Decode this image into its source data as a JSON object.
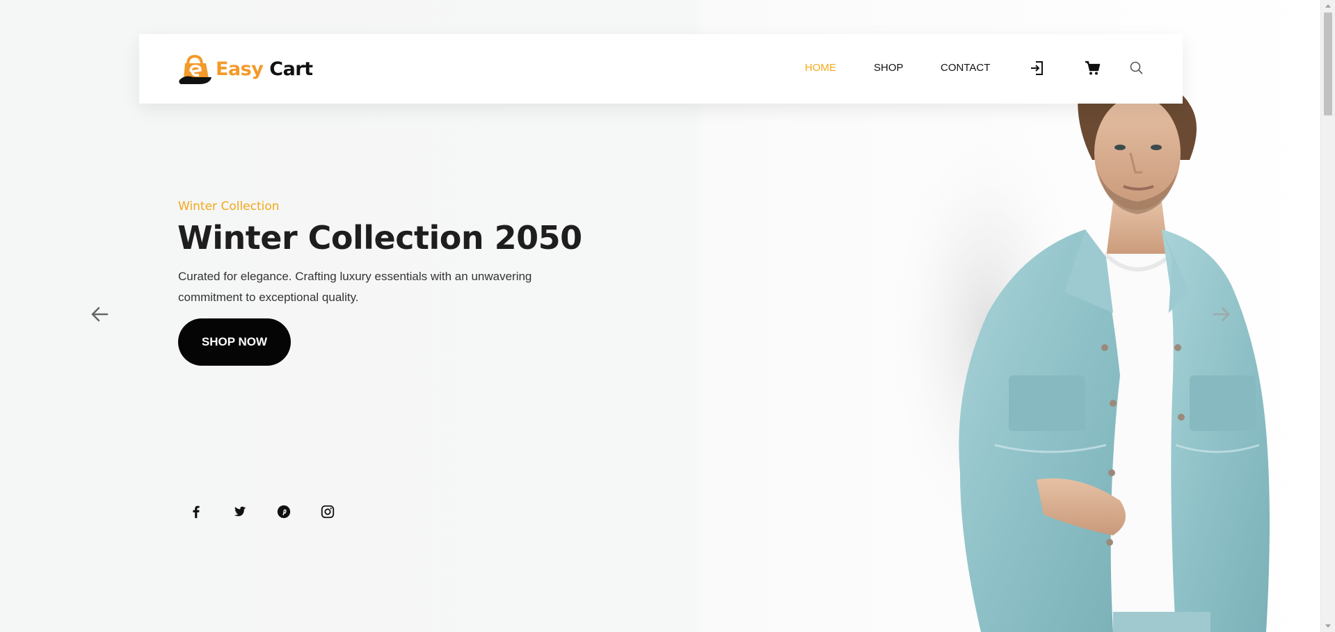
{
  "brand": {
    "name_part1": "Easy",
    "name_part2": "Cart",
    "accent_color": "#f3a81a"
  },
  "nav": {
    "links": [
      {
        "label": "HOME",
        "active": true
      },
      {
        "label": "SHOP",
        "active": false
      },
      {
        "label": "CONTACT",
        "active": false
      }
    ],
    "icons": [
      "login-icon",
      "cart-icon",
      "search-icon"
    ]
  },
  "hero": {
    "eyebrow": "Winter Collection",
    "title": "Winter Collection 2050",
    "description": "Curated for elegance. Crafting luxury essentials with an unwavering commitment to exceptional quality.",
    "cta_label": "SHOP NOW",
    "image_alt": "man-in-denim-jacket"
  },
  "carousel": {
    "prev_icon": "arrow-left-icon",
    "next_icon": "arrow-right-icon"
  },
  "socials": [
    "facebook-icon",
    "twitter-icon",
    "pinterest-icon",
    "instagram-icon"
  ]
}
